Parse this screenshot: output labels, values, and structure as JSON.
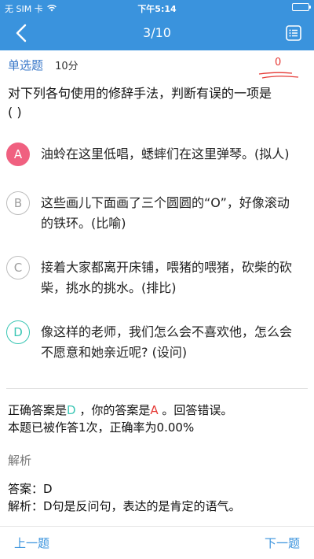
{
  "status_bar": {
    "carrier": "无 SIM 卡",
    "time": "下午5:14",
    "battery_level": 1.0
  },
  "nav": {
    "title": "3/10"
  },
  "question_header": {
    "type": "单选题",
    "score": "10分",
    "mark": "0"
  },
  "question": {
    "text": "对下列各句使用的修辞手法，判断有误的一项是",
    "blank": "(        )"
  },
  "options": [
    {
      "letter": "A",
      "text": "油蛉在这里低唱，蟋蟀们在这里弹琴。(拟人)",
      "state": "wrong"
    },
    {
      "letter": "B",
      "text": "这些画儿下面画了三个圆圆的“O”，好像滚动的铁环。(比喻)",
      "state": "normal"
    },
    {
      "letter": "C",
      "text": "接着大家都离开床铺，喂猪的喂猪，砍柴的砍柴，挑水的挑水。(排比)",
      "state": "normal"
    },
    {
      "letter": "D",
      "text": "像这样的老师，我们怎么会不喜欢他，怎么会不愿意和她亲近呢? (设问)",
      "state": "right"
    }
  ],
  "result": {
    "correct_prefix": "正确答案是",
    "correct_answer": "D",
    "your_prefix": " ，你的答案是",
    "your_answer": "A",
    "suffix": " 。回答错误。",
    "stats": "本题已被作答1次，正确率为0.00%"
  },
  "analysis": {
    "title": "解析",
    "answer_line": "答案：D",
    "explanation_line": "解析：D句是反问句，表达的是肯定的语气。"
  },
  "bottom": {
    "prev": "上一题",
    "next": "下一题"
  },
  "colors": {
    "primary": "#3a93dd",
    "wrong": "#f06080",
    "right": "#3ac6b4",
    "red_text": "#e53935"
  }
}
